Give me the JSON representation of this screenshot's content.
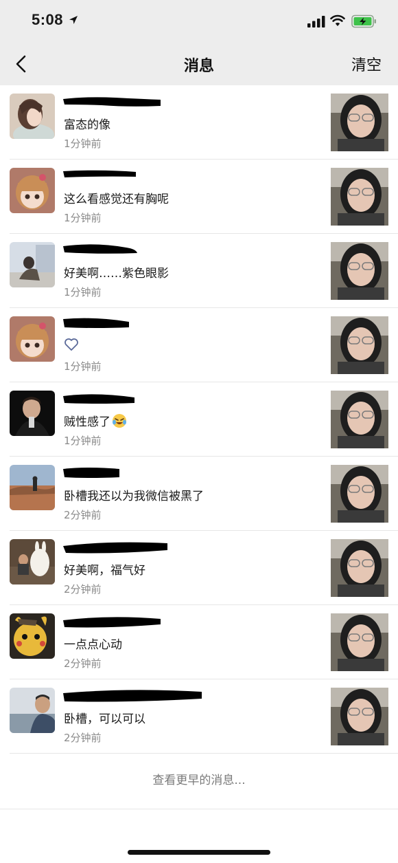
{
  "status_bar": {
    "time": "5:08"
  },
  "nav": {
    "title": "消息",
    "clear_label": "清空"
  },
  "messages": [
    {
      "text": "富态的像",
      "time": "1分钟前"
    },
    {
      "text": "这么看感觉还有胸呢",
      "time": "1分钟前"
    },
    {
      "text": "好美啊……紫色眼影",
      "time": "1分钟前"
    },
    {
      "text": "",
      "time": "1分钟前",
      "icon": "heart-icon"
    },
    {
      "text": "贼性感了",
      "time": "1分钟前",
      "icon": "laughing-crying-emoji-icon"
    },
    {
      "text": "卧槽我还以为我微信被黑了",
      "time": "2分钟前"
    },
    {
      "text": "好美啊，福气好",
      "time": "2分钟前"
    },
    {
      "text": "一点点心动",
      "time": "2分钟前"
    },
    {
      "text": "卧槽，可以可以",
      "time": "2分钟前"
    }
  ],
  "footer": {
    "more_label": "查看更早的消息..."
  },
  "colors": {
    "nav_bg": "#ededed",
    "meta_text": "#8a8a8a",
    "heart": "#5b6a99"
  }
}
